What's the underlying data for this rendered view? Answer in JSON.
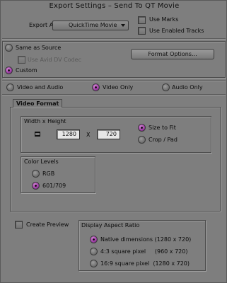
{
  "window": {
    "title": "Export Settings – Send To QT Movie"
  },
  "export": {
    "label": "Export As:",
    "format_selected": "QuickTime Movie",
    "use_marks": "Use Marks",
    "use_enabled_tracks": "Use Enabled Tracks"
  },
  "source": {
    "same_as_source": "Same as Source",
    "use_avid_dv_codec": "Use Avid DV Codec",
    "custom": "Custom",
    "format_options_button": "Format Options..."
  },
  "av": {
    "video_and_audio": "Video and Audio",
    "video_only": "Video Only",
    "audio_only": "Audio Only",
    "selected": "Video Only"
  },
  "video_format": {
    "tab": "Video Format",
    "width_height_label": "Width x Height",
    "width": "1280",
    "x_label": "X",
    "height": "720",
    "size_to_fit": "Size to Fit",
    "crop_pad": "Crop / Pad",
    "scaling_selected": "Size to Fit"
  },
  "color_levels": {
    "label": "Color Levels",
    "rgb": "RGB",
    "ycc": "601/709",
    "selected": "601/709"
  },
  "preview": {
    "create_preview": "Create Preview"
  },
  "aspect": {
    "label": "Display Aspect Ratio",
    "native": "Native dimensions  (1280 x 720)",
    "square_43": "4:3 square pixel     (960 x 720)",
    "square_169": "16:9 square pixel  (1280 x 720)",
    "selected": "Native dimensions"
  },
  "colors": {
    "window_bg": "#7e7e7e",
    "radio_selected": "#a040a8",
    "field_bg": "#e6e6e6"
  }
}
